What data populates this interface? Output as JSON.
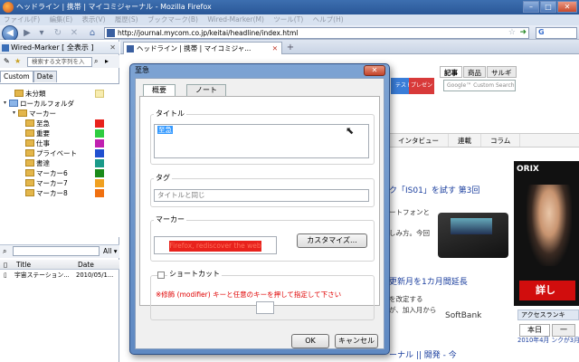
{
  "window": {
    "title": "ヘッドライン | 携帯 | マイコミジャーナル - Mozilla Firefox",
    "controls": {
      "minimize": "–",
      "maximize": "□",
      "close": "✕"
    }
  },
  "menubar": [
    "ファイル(F)",
    "編集(E)",
    "表示(V)",
    "履歴(S)",
    "ブックマーク(B)",
    "Wired-Marker(M)",
    "ツール(T)",
    "ヘルプ(H)"
  ],
  "navbar": {
    "url": "http://journal.mycom.co.jp/keitai/headline/index.html",
    "search_logo": "G"
  },
  "sidebar": {
    "header": "Wired-Marker [ 全表示 ]",
    "search_placeholder": "検索する文字列を入",
    "tabs": [
      "Custom",
      "Date"
    ],
    "tree": [
      {
        "label": "未分類",
        "color": "#f7ecb0"
      },
      {
        "label": "ローカルフォルダ"
      },
      {
        "label": "マーカー"
      },
      {
        "label": "至急",
        "color": "#e8221c"
      },
      {
        "label": "重要",
        "color": "#2ecc40"
      },
      {
        "label": "仕事",
        "color": "#c020b0"
      },
      {
        "label": "プライベート",
        "color": "#2050d0"
      },
      {
        "label": "書達",
        "color": "#1a9a8a"
      },
      {
        "label": "マーカー6",
        "color": "#1a8a1a"
      },
      {
        "label": "マーカー7",
        "color": "#f0a020"
      },
      {
        "label": "マーカー8",
        "color": "#f07010"
      }
    ],
    "filter_all": "All",
    "list_columns": {
      "title": "Title",
      "date": "Date"
    },
    "list_rows": [
      {
        "title": "宇宙ステーション...",
        "date": "2010/05/1..."
      }
    ]
  },
  "browser_tab": {
    "label": "ヘッドライン | 携帯 | マイコミジャ..."
  },
  "site": {
    "tabs": [
      "記事",
      "商品",
      "サルギ"
    ],
    "search_placeholder": "Google™ Custom Search",
    "btn1": "テスト",
    "btn2": "プレゼント",
    "nav": [
      "インタビュー",
      "連載",
      "コラム"
    ],
    "headline1": "ク「IS01」を試す 第3回",
    "snip1": "ートフォンと",
    "snip2": "しみ方。今回",
    "headline2": "更新月を1カ月間延長",
    "snip3": "を改定する",
    "snip4": "が、加入月から",
    "brand": "SoftBank",
    "headline3": "ーナル || 開発 - 今",
    "ad_brand": "ORIX",
    "ad_cta": "詳し",
    "ranking_title": "アクセスランキ",
    "ranking_tabs": [
      "本日",
      "一"
    ],
    "ranking_item": "2010年4月 ンクが3月"
  },
  "dialog": {
    "title": "至急",
    "close": "✕",
    "tabs": [
      "概要",
      "ノート"
    ],
    "title_label": "タイトル",
    "title_value": "至急",
    "tag_label": "タグ",
    "tag_placeholder": "タイトルと同じ",
    "marker_label": "マーカー",
    "marker_sample": "Firefox, rediscover the web",
    "customize_button": "カスタマイズ...",
    "shortcut_label": "ショートカット",
    "shortcut_note": "※修飾 (modifier) キーと任意のキーを押して指定して下さい",
    "ok_button": "OK",
    "cancel_button": "キャンセル"
  }
}
